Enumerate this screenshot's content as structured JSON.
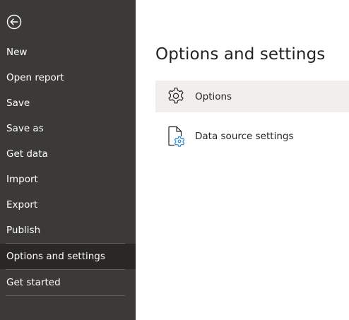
{
  "sidebar": {
    "back_icon": "back-arrow-circle-icon",
    "items": [
      {
        "label": "New"
      },
      {
        "label": "Open report"
      },
      {
        "label": "Save"
      },
      {
        "label": "Save as"
      },
      {
        "label": "Get data"
      },
      {
        "label": "Import"
      },
      {
        "label": "Export"
      },
      {
        "label": "Publish"
      },
      {
        "label": "Options and settings",
        "selected": true
      },
      {
        "label": "Get started"
      }
    ]
  },
  "main": {
    "title": "Options and settings",
    "options": [
      {
        "label": "Options",
        "icon": "gear-icon",
        "highlighted": true
      },
      {
        "label": "Data source settings",
        "icon": "document-gear-icon"
      }
    ]
  },
  "colors": {
    "sidebar_bg": "#3b3a39",
    "sidebar_selected_bg": "#292827",
    "accent_blue": "#2b88d8",
    "highlight_bg": "#f0efee"
  }
}
